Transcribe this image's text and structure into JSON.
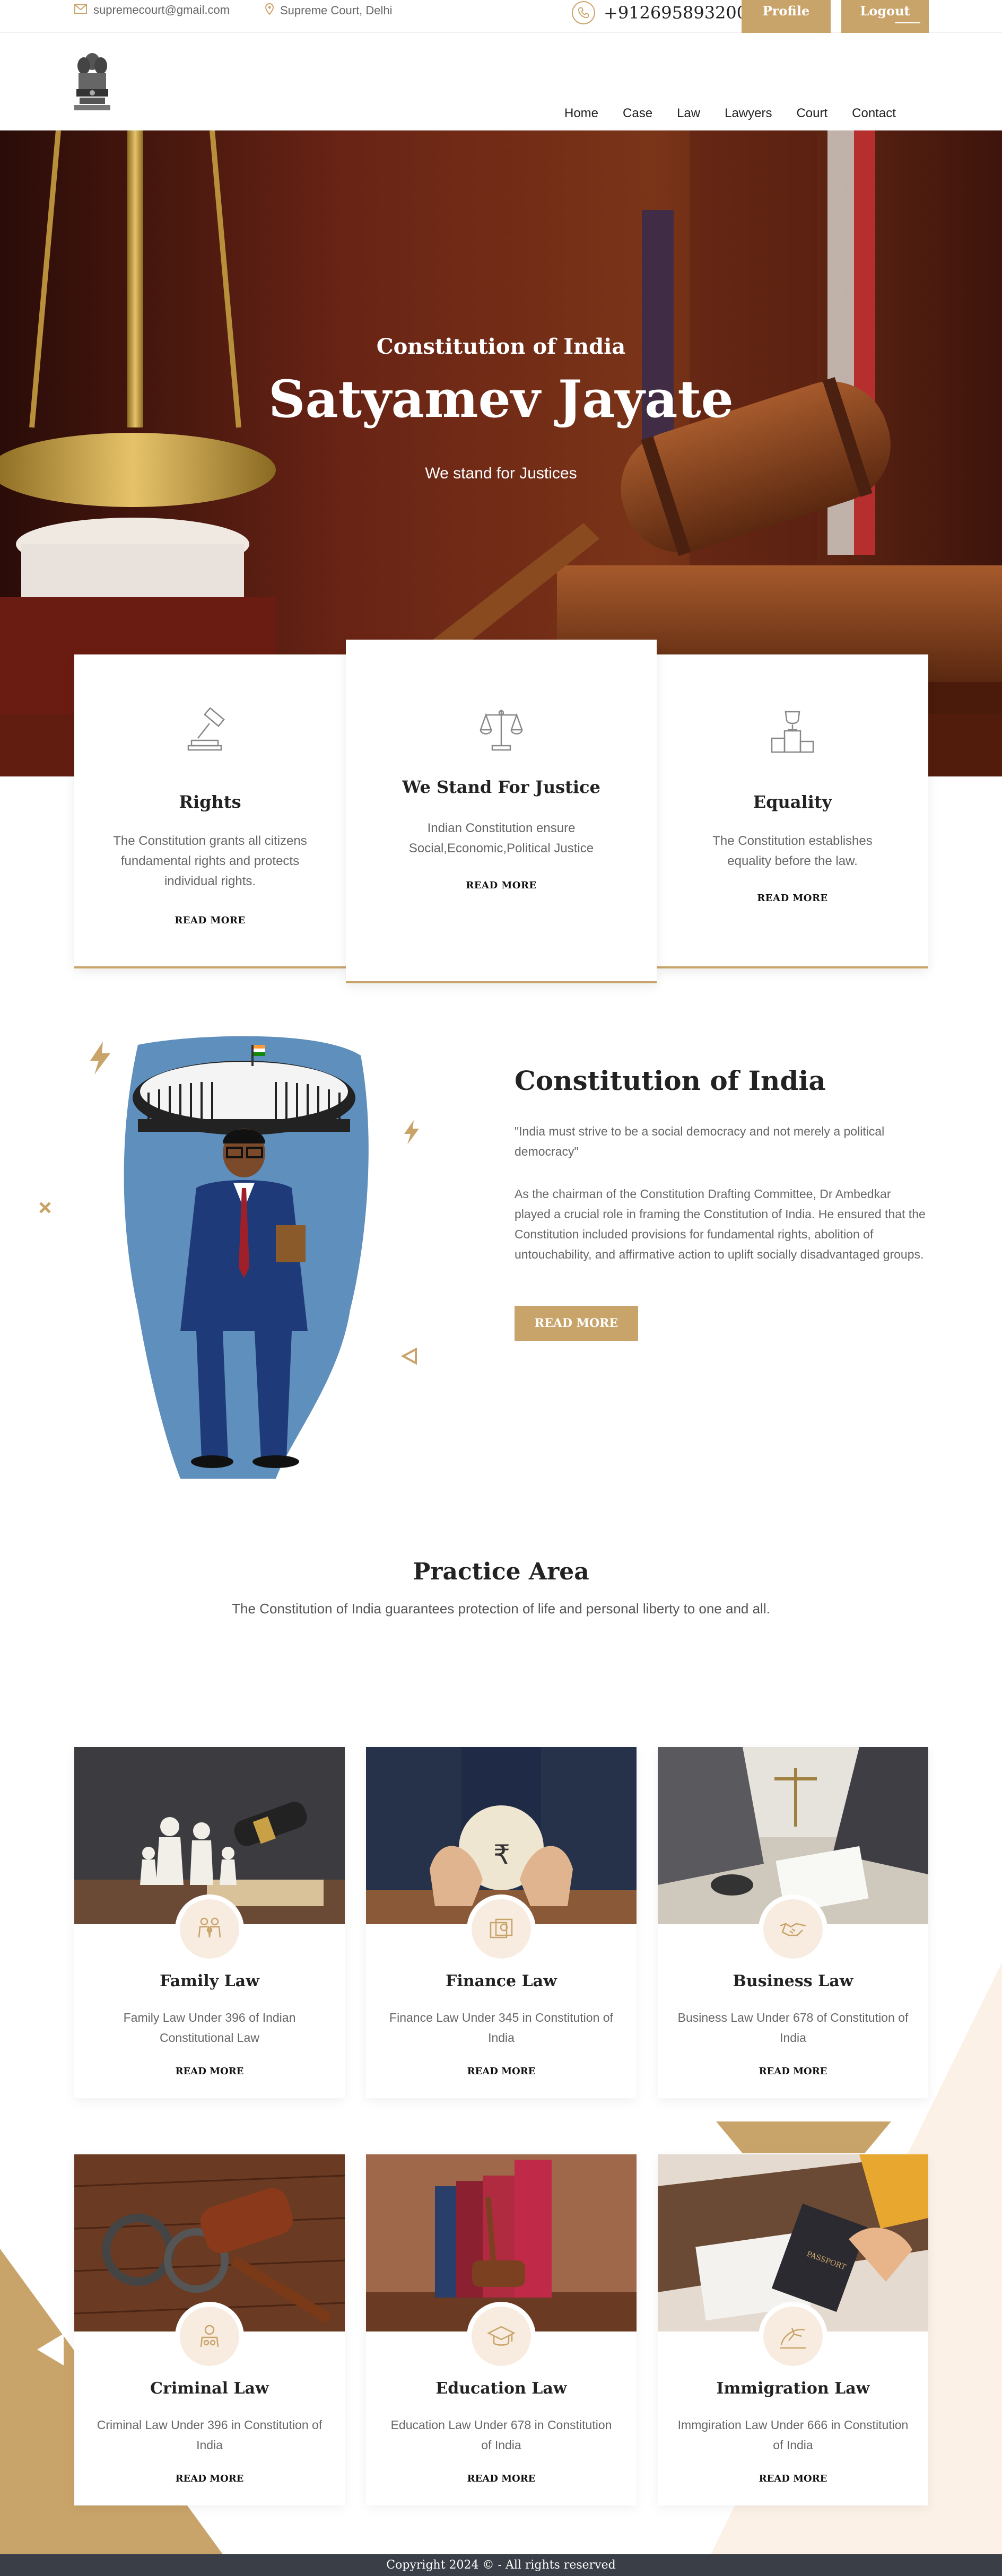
{
  "topbar": {
    "email": "supremecourt@gmail.com",
    "location": "Supreme Court, Delhi",
    "phone": "+912695893200",
    "profile_label": "Profile",
    "logout_label": "Logout"
  },
  "nav": {
    "items": [
      "Home",
      "Case",
      "Law",
      "Lawyers",
      "Court",
      "Contact"
    ]
  },
  "hero": {
    "subtitle": "Constitution of India",
    "title": "Satyamev Jayate",
    "tagline": "We stand for Justices"
  },
  "features": [
    {
      "title": "Rights",
      "text": "The Constitution grants all citizens fundamental rights and protects individual rights.",
      "link": "READ MORE",
      "icon": "gavel-icon"
    },
    {
      "title": "We Stand For Justice",
      "text": "Indian Constitution ensure Social,Economic,Political Justice",
      "link": "READ MORE",
      "icon": "scales-icon"
    },
    {
      "title": "Equality",
      "text": "The Constitution establishes equality before the law.",
      "link": "READ MORE",
      "icon": "podium-icon"
    }
  ],
  "about": {
    "title": "Constitution of India",
    "quote": "\"India must strive to be a social democracy and not merely a political democracy\"",
    "description": "As the chairman of the Constitution Drafting Committee, Dr Ambedkar played a crucial role in framing the Constitution of India. He ensured that the Constitution included provisions for fundamental rights, abolition of untouchability, and affirmative action to uplift socially disadvantaged groups.",
    "button": "READ MORE"
  },
  "practice": {
    "title": "Practice Area",
    "subtitle": "The Constitution of India guarantees protection of life and personal liberty to one and all.",
    "cards": [
      {
        "title": "Family Law",
        "text": "Family Law Under 396 of Indian Constitutional Law",
        "link": "READ MORE",
        "icon": "family-icon"
      },
      {
        "title": "Finance Law",
        "text": "Finance Law Under 345 in Constitution of India",
        "link": "READ MORE",
        "icon": "money-icon"
      },
      {
        "title": "Business Law",
        "text": "Business Law Under 678 of Constitution of India",
        "link": "READ MORE",
        "icon": "handshake-icon"
      },
      {
        "title": "Criminal Law",
        "text": "Criminal Law Under 396 in Constitution of India",
        "link": "READ MORE",
        "icon": "criminal-icon"
      },
      {
        "title": "Education Law",
        "text": "Education Law Under 678 in Constitution of India",
        "link": "READ MORE",
        "icon": "graduation-cap-icon"
      },
      {
        "title": "Immigration Law",
        "text": "Immgiration Law Under 666 in Constitution of India",
        "link": "READ MORE",
        "icon": "plane-icon"
      }
    ]
  },
  "footer": {
    "text": "Copyright 2024 © - All rights reserved"
  },
  "colors": {
    "accent": "#c9a46a",
    "footer_bg": "#3a3f47",
    "badge_bg": "#f8ece0"
  }
}
